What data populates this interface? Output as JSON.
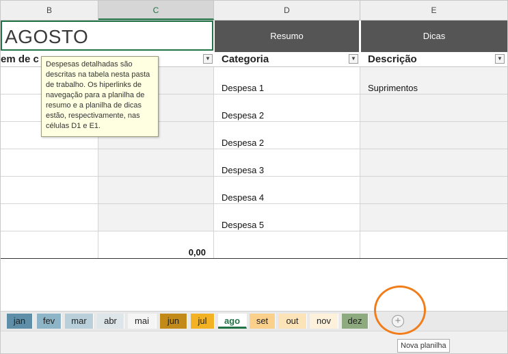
{
  "columns": [
    "B",
    "C",
    "D",
    "E"
  ],
  "title": "AGOSTO",
  "buttons": {
    "resumo": "Resumo",
    "dicas": "Dicas"
  },
  "table_headers": [
    "em de c",
    "",
    "Categoria",
    "Descrição"
  ],
  "tooltip": "Despesas detalhadas são descritas na tabela nesta pasta de trabalho. Os hiperlinks de navegação para a planilha de resumo e a planilha de dicas estão, respectivamente, nas células D1 e E1.",
  "rows": [
    {
      "category": "Despesa 1",
      "description": "Suprimentos"
    },
    {
      "category": "Despesa 2",
      "description": ""
    },
    {
      "category": "Despesa 2",
      "description": ""
    },
    {
      "category": "Despesa 3",
      "description": ""
    },
    {
      "category": "Despesa 4",
      "description": ""
    },
    {
      "category": "Despesa 5",
      "description": ""
    }
  ],
  "total": "0,00",
  "sheet_tabs": [
    {
      "label": "jan",
      "color": "#5f8fa8"
    },
    {
      "label": "fev",
      "color": "#8eb4c7"
    },
    {
      "label": "mar",
      "color": "#b9cfd9"
    },
    {
      "label": "abr",
      "color": "#dfe6ea"
    },
    {
      "label": "mai",
      "color": "#f5f5f5"
    },
    {
      "label": "jun",
      "color": "#c28a18"
    },
    {
      "label": "jul",
      "color": "#f3b223"
    },
    {
      "label": "ago",
      "color": "#ffffff",
      "active": true
    },
    {
      "label": "set",
      "color": "#fbd08a"
    },
    {
      "label": "out",
      "color": "#fde4b8"
    },
    {
      "label": "nov",
      "color": "#fdf1dc"
    },
    {
      "label": "dez",
      "color": "#8eab7f"
    }
  ],
  "add_sheet_tooltip": "Nova planilha",
  "icons": {
    "add_sheet": "plus-circle-icon",
    "filter": "dropdown-arrow-icon"
  },
  "accent_color": "#217346",
  "highlight_color": "#f17d1a"
}
